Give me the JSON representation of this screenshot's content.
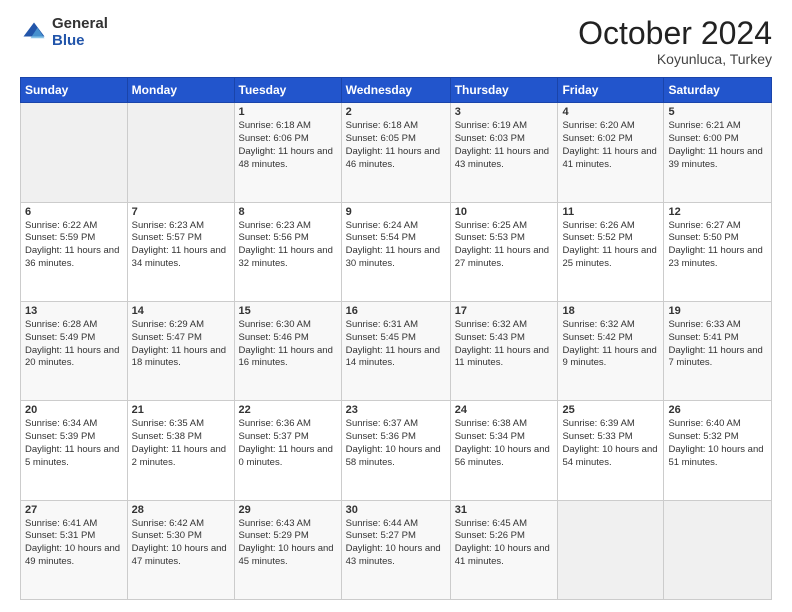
{
  "header": {
    "logo_general": "General",
    "logo_blue": "Blue",
    "month": "October 2024",
    "location": "Koyunluca, Turkey"
  },
  "weekdays": [
    "Sunday",
    "Monday",
    "Tuesday",
    "Wednesday",
    "Thursday",
    "Friday",
    "Saturday"
  ],
  "weeks": [
    [
      {
        "day": "",
        "sunrise": "",
        "sunset": "",
        "daylight": ""
      },
      {
        "day": "",
        "sunrise": "",
        "sunset": "",
        "daylight": ""
      },
      {
        "day": "1",
        "sunrise": "Sunrise: 6:18 AM",
        "sunset": "Sunset: 6:06 PM",
        "daylight": "Daylight: 11 hours and 48 minutes."
      },
      {
        "day": "2",
        "sunrise": "Sunrise: 6:18 AM",
        "sunset": "Sunset: 6:05 PM",
        "daylight": "Daylight: 11 hours and 46 minutes."
      },
      {
        "day": "3",
        "sunrise": "Sunrise: 6:19 AM",
        "sunset": "Sunset: 6:03 PM",
        "daylight": "Daylight: 11 hours and 43 minutes."
      },
      {
        "day": "4",
        "sunrise": "Sunrise: 6:20 AM",
        "sunset": "Sunset: 6:02 PM",
        "daylight": "Daylight: 11 hours and 41 minutes."
      },
      {
        "day": "5",
        "sunrise": "Sunrise: 6:21 AM",
        "sunset": "Sunset: 6:00 PM",
        "daylight": "Daylight: 11 hours and 39 minutes."
      }
    ],
    [
      {
        "day": "6",
        "sunrise": "Sunrise: 6:22 AM",
        "sunset": "Sunset: 5:59 PM",
        "daylight": "Daylight: 11 hours and 36 minutes."
      },
      {
        "day": "7",
        "sunrise": "Sunrise: 6:23 AM",
        "sunset": "Sunset: 5:57 PM",
        "daylight": "Daylight: 11 hours and 34 minutes."
      },
      {
        "day": "8",
        "sunrise": "Sunrise: 6:23 AM",
        "sunset": "Sunset: 5:56 PM",
        "daylight": "Daylight: 11 hours and 32 minutes."
      },
      {
        "day": "9",
        "sunrise": "Sunrise: 6:24 AM",
        "sunset": "Sunset: 5:54 PM",
        "daylight": "Daylight: 11 hours and 30 minutes."
      },
      {
        "day": "10",
        "sunrise": "Sunrise: 6:25 AM",
        "sunset": "Sunset: 5:53 PM",
        "daylight": "Daylight: 11 hours and 27 minutes."
      },
      {
        "day": "11",
        "sunrise": "Sunrise: 6:26 AM",
        "sunset": "Sunset: 5:52 PM",
        "daylight": "Daylight: 11 hours and 25 minutes."
      },
      {
        "day": "12",
        "sunrise": "Sunrise: 6:27 AM",
        "sunset": "Sunset: 5:50 PM",
        "daylight": "Daylight: 11 hours and 23 minutes."
      }
    ],
    [
      {
        "day": "13",
        "sunrise": "Sunrise: 6:28 AM",
        "sunset": "Sunset: 5:49 PM",
        "daylight": "Daylight: 11 hours and 20 minutes."
      },
      {
        "day": "14",
        "sunrise": "Sunrise: 6:29 AM",
        "sunset": "Sunset: 5:47 PM",
        "daylight": "Daylight: 11 hours and 18 minutes."
      },
      {
        "day": "15",
        "sunrise": "Sunrise: 6:30 AM",
        "sunset": "Sunset: 5:46 PM",
        "daylight": "Daylight: 11 hours and 16 minutes."
      },
      {
        "day": "16",
        "sunrise": "Sunrise: 6:31 AM",
        "sunset": "Sunset: 5:45 PM",
        "daylight": "Daylight: 11 hours and 14 minutes."
      },
      {
        "day": "17",
        "sunrise": "Sunrise: 6:32 AM",
        "sunset": "Sunset: 5:43 PM",
        "daylight": "Daylight: 11 hours and 11 minutes."
      },
      {
        "day": "18",
        "sunrise": "Sunrise: 6:32 AM",
        "sunset": "Sunset: 5:42 PM",
        "daylight": "Daylight: 11 hours and 9 minutes."
      },
      {
        "day": "19",
        "sunrise": "Sunrise: 6:33 AM",
        "sunset": "Sunset: 5:41 PM",
        "daylight": "Daylight: 11 hours and 7 minutes."
      }
    ],
    [
      {
        "day": "20",
        "sunrise": "Sunrise: 6:34 AM",
        "sunset": "Sunset: 5:39 PM",
        "daylight": "Daylight: 11 hours and 5 minutes."
      },
      {
        "day": "21",
        "sunrise": "Sunrise: 6:35 AM",
        "sunset": "Sunset: 5:38 PM",
        "daylight": "Daylight: 11 hours and 2 minutes."
      },
      {
        "day": "22",
        "sunrise": "Sunrise: 6:36 AM",
        "sunset": "Sunset: 5:37 PM",
        "daylight": "Daylight: 11 hours and 0 minutes."
      },
      {
        "day": "23",
        "sunrise": "Sunrise: 6:37 AM",
        "sunset": "Sunset: 5:36 PM",
        "daylight": "Daylight: 10 hours and 58 minutes."
      },
      {
        "day": "24",
        "sunrise": "Sunrise: 6:38 AM",
        "sunset": "Sunset: 5:34 PM",
        "daylight": "Daylight: 10 hours and 56 minutes."
      },
      {
        "day": "25",
        "sunrise": "Sunrise: 6:39 AM",
        "sunset": "Sunset: 5:33 PM",
        "daylight": "Daylight: 10 hours and 54 minutes."
      },
      {
        "day": "26",
        "sunrise": "Sunrise: 6:40 AM",
        "sunset": "Sunset: 5:32 PM",
        "daylight": "Daylight: 10 hours and 51 minutes."
      }
    ],
    [
      {
        "day": "27",
        "sunrise": "Sunrise: 6:41 AM",
        "sunset": "Sunset: 5:31 PM",
        "daylight": "Daylight: 10 hours and 49 minutes."
      },
      {
        "day": "28",
        "sunrise": "Sunrise: 6:42 AM",
        "sunset": "Sunset: 5:30 PM",
        "daylight": "Daylight: 10 hours and 47 minutes."
      },
      {
        "day": "29",
        "sunrise": "Sunrise: 6:43 AM",
        "sunset": "Sunset: 5:29 PM",
        "daylight": "Daylight: 10 hours and 45 minutes."
      },
      {
        "day": "30",
        "sunrise": "Sunrise: 6:44 AM",
        "sunset": "Sunset: 5:27 PM",
        "daylight": "Daylight: 10 hours and 43 minutes."
      },
      {
        "day": "31",
        "sunrise": "Sunrise: 6:45 AM",
        "sunset": "Sunset: 5:26 PM",
        "daylight": "Daylight: 10 hours and 41 minutes."
      },
      {
        "day": "",
        "sunrise": "",
        "sunset": "",
        "daylight": ""
      },
      {
        "day": "",
        "sunrise": "",
        "sunset": "",
        "daylight": ""
      }
    ]
  ]
}
